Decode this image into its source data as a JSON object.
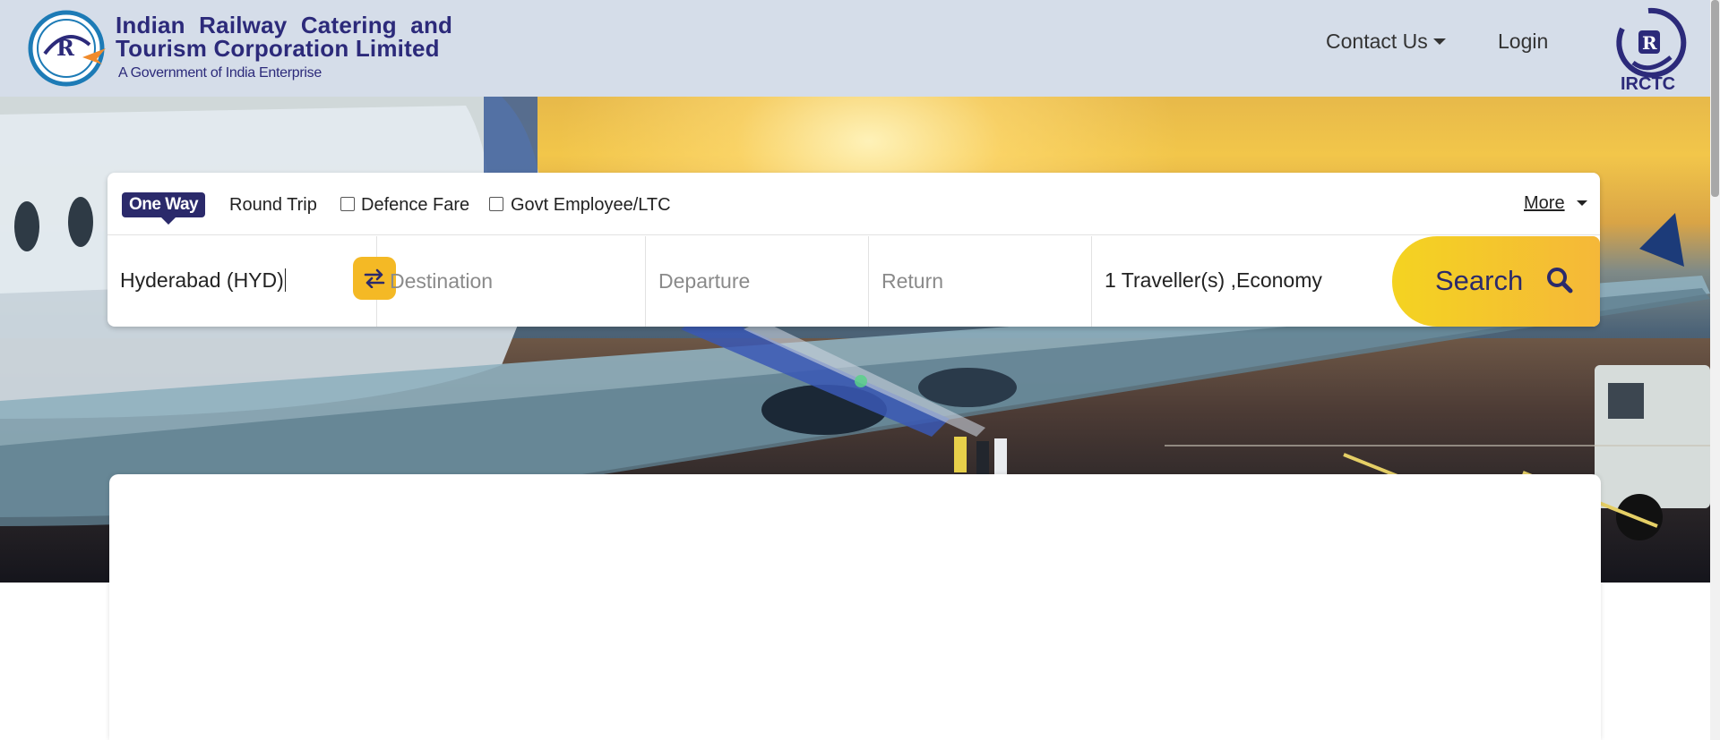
{
  "header": {
    "brand_line1": "Indian Railway Catering and",
    "brand_line2": "Tourism Corporation Limited",
    "brand_sub": "A Government of India Enterprise",
    "nav": {
      "contact_label": "Contact Us",
      "login_label": "Login"
    },
    "right_logo_text": "IRCTC"
  },
  "search": {
    "trip_types": {
      "one_way": "One Way",
      "round_trip": "Round Trip"
    },
    "options": {
      "defence_fare": "Defence Fare",
      "defence_fare_checked": false,
      "govt_employee": "Govt Employee/LTC",
      "govt_employee_checked": false
    },
    "more_label": "More",
    "origin_value": "Hyderabad (HYD)",
    "destination_placeholder": "Destination",
    "departure_placeholder": "Departure",
    "return_placeholder": "Return",
    "travellers_value": "1 Traveller(s) ,Economy",
    "search_label": "Search"
  },
  "colors": {
    "brand_navy": "#2b2a6b",
    "accent_yellow": "#f4b925",
    "header_bg": "#d5dde9"
  },
  "icons": {
    "swap": "swap-arrows-icon",
    "search": "magnifier-icon",
    "logo": "irctc-logo-icon"
  }
}
